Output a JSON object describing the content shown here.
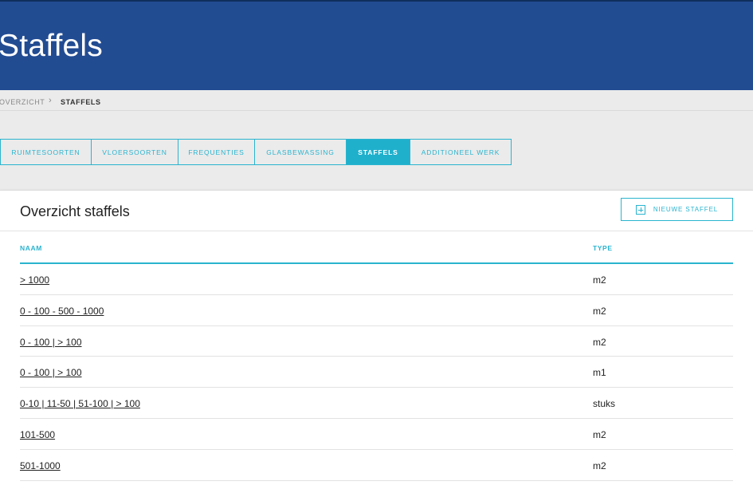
{
  "header": {
    "title": "Staffels"
  },
  "breadcrumb": {
    "items": [
      "OVERZICHT",
      "STAFFELS"
    ]
  },
  "tabs": [
    {
      "label": "RUIMTESOORTEN",
      "active": false
    },
    {
      "label": "VLOERSOORTEN",
      "active": false
    },
    {
      "label": "FREQUENTIES",
      "active": false
    },
    {
      "label": "GLASBEWASSING",
      "active": false
    },
    {
      "label": "STAFFELS",
      "active": true
    },
    {
      "label": "ADDITIONEEL WERK",
      "active": false
    }
  ],
  "card": {
    "title": "Overzicht staffels",
    "new_button_label": "NIEUWE STAFFEL"
  },
  "table": {
    "headers": {
      "naam": "NAAM",
      "type": "TYPE"
    },
    "rows": [
      {
        "naam": "> 1000",
        "type": "m2"
      },
      {
        "naam": "0 - 100 - 500 - 1000",
        "type": "m2"
      },
      {
        "naam": "0 - 100 | > 100",
        "type": "m2"
      },
      {
        "naam": "0 - 100 | > 100",
        "type": "m1"
      },
      {
        "naam": "0-10 | 11-50 | 51-100 | > 100",
        "type": "stuks"
      },
      {
        "naam": "101-500",
        "type": "m2"
      },
      {
        "naam": "501-1000",
        "type": "m2"
      }
    ]
  },
  "colors": {
    "header_bg": "#224c92",
    "accent": "#2ab4cf",
    "page_bg": "#ebebeb"
  }
}
